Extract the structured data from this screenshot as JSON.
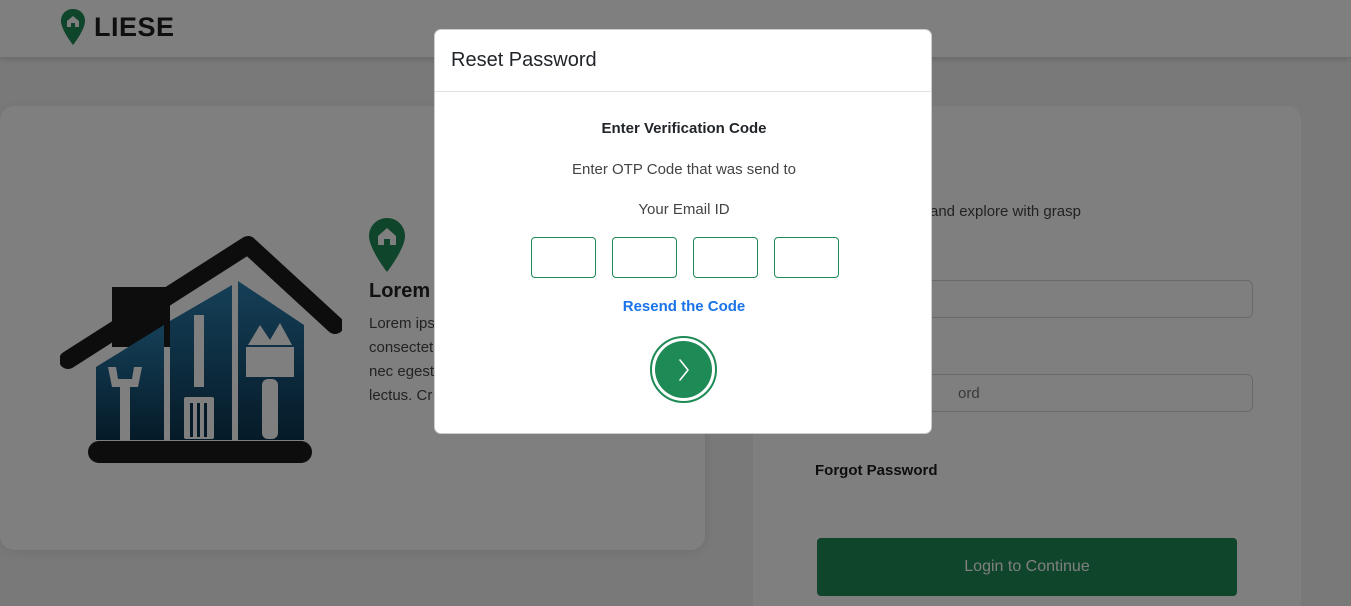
{
  "navbar": {
    "brand_name": "LIESE",
    "logo_icon": "location-pin-house-icon"
  },
  "info_card": {
    "illustration": "house-with-tools-illustration",
    "pin_icon": "location-pin-house-icon",
    "title_visible": "Lorem i",
    "text_lines": [
      "Lorem ips",
      "consectet",
      "nec egest",
      "lectus. Cr"
    ]
  },
  "login_card": {
    "subtitle_visible": "and explore with grasp",
    "password_placeholder_visible": "ord",
    "forgot_label": "Forgot Password",
    "login_button_label": "Login to Continue"
  },
  "modal": {
    "title": "Reset Password",
    "heading": "Enter Verification Code",
    "line1": "Enter OTP Code that was send to",
    "line2": "Your Email ID",
    "otp_values": [
      "",
      "",
      "",
      ""
    ],
    "resend_label": "Resend the Code",
    "next_icon": "chevron-right-icon"
  },
  "colors": {
    "brand_green": "#1e8a55",
    "link_blue": "#1a73e8",
    "backdrop": "rgba(0,0,0,0.5)"
  }
}
